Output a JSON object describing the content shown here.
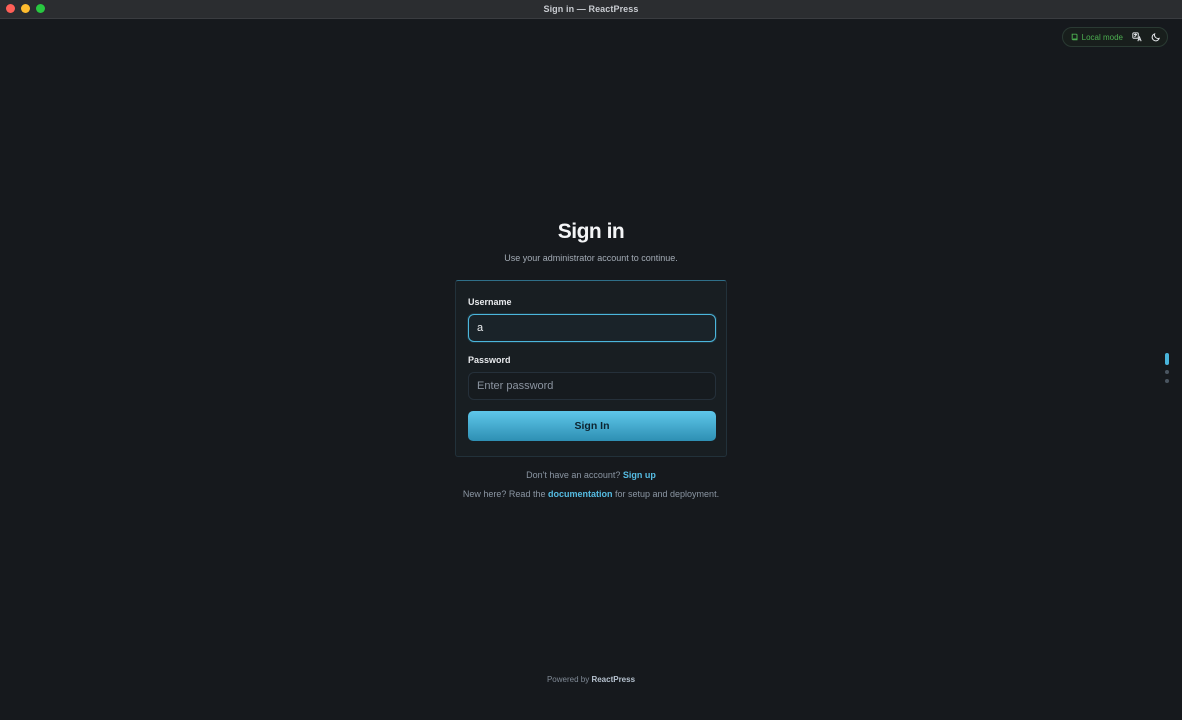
{
  "window": {
    "title": "Sign in — ReactPress"
  },
  "top_controls": {
    "local_mode_label": "Local mode",
    "local_mode_color": "#4caf50",
    "translate_icon": "translate-icon",
    "theme_icon": "moon-icon"
  },
  "header": {
    "title": "Sign in",
    "subtitle": "Use your administrator account to continue."
  },
  "form": {
    "username_label": "Username",
    "username_value": "a",
    "password_label": "Password",
    "password_placeholder": "Enter password",
    "submit_label": "Sign In"
  },
  "footer": {
    "signup_prompt": "Don't have an account?",
    "signup_link": "Sign up",
    "docs_prefix": "New here? Read the",
    "docs_link": "documentation",
    "docs_suffix": "for setup and deployment.",
    "powered_prefix": "Powered by",
    "powered_brand": "ReactPress"
  },
  "colors": {
    "accent": "#4bb6dc",
    "background": "#16191d"
  }
}
